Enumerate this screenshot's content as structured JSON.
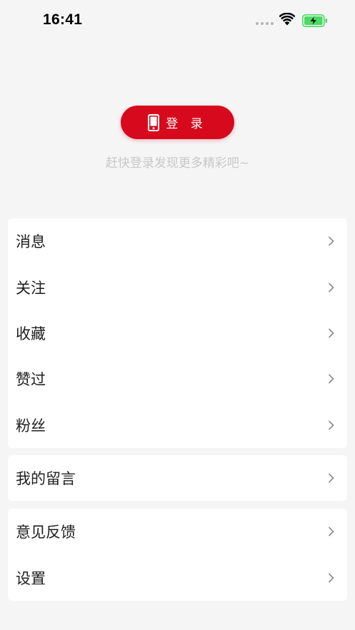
{
  "status_bar": {
    "time": "16:41",
    "battery_state": "charging",
    "battery_color": "#4cd964"
  },
  "profile": {
    "login_button_label": "登 录",
    "login_hint": "赶快登录发现更多精彩吧~",
    "accent_color": "#d7091c"
  },
  "menu_groups": [
    {
      "items": [
        {
          "label": "消息",
          "icon": "chevron-right-icon"
        },
        {
          "label": "关注",
          "icon": "chevron-right-icon"
        },
        {
          "label": "收藏",
          "icon": "chevron-right-icon"
        },
        {
          "label": "赞过",
          "icon": "chevron-right-icon"
        },
        {
          "label": "粉丝",
          "icon": "chevron-right-icon"
        }
      ]
    },
    {
      "items": [
        {
          "label": "我的留言",
          "icon": "chevron-right-icon"
        }
      ]
    },
    {
      "items": [
        {
          "label": "意见反馈",
          "icon": "chevron-right-icon"
        },
        {
          "label": "设置",
          "icon": "chevron-right-icon"
        }
      ]
    }
  ]
}
